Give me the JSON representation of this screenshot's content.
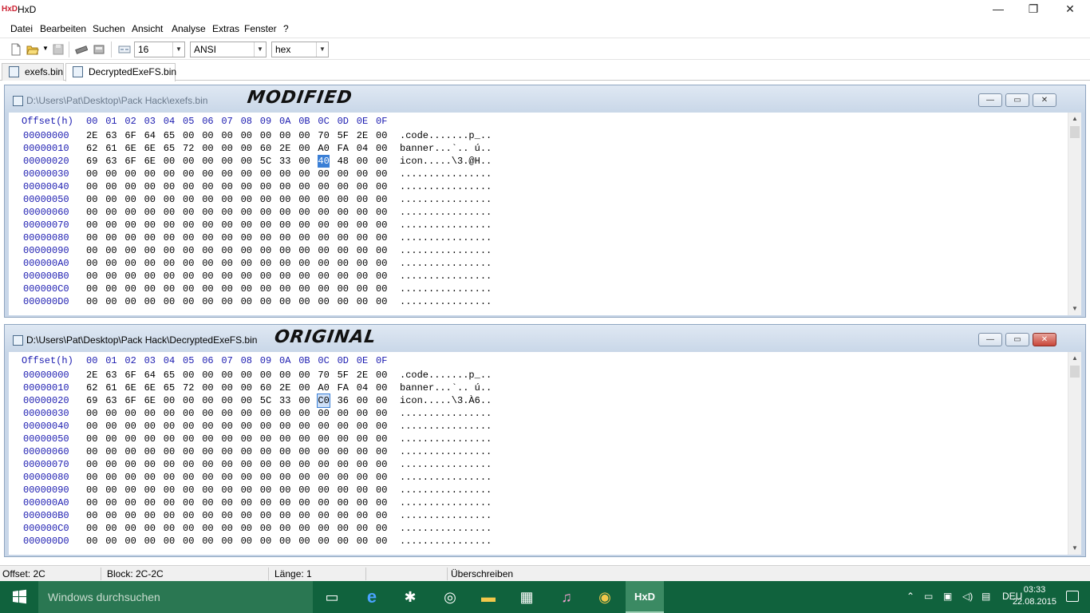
{
  "app": {
    "title": "HxD",
    "logo": "HxD"
  },
  "window_controls": {
    "minimize": "—",
    "maximize": "❐",
    "close": "✕"
  },
  "menu": [
    "Datei",
    "Bearbeiten",
    "Suchen",
    "Ansicht",
    "Analyse",
    "Extras",
    "Fenster",
    "?"
  ],
  "toolbar": {
    "bytes_per_row": "16",
    "charset": "ANSI",
    "offset_base": "hex",
    "icons": [
      "new-file-icon",
      "open-folder-icon",
      "save-icon",
      "ram-icon",
      "disk-icon",
      "bytes-per-row-icon"
    ]
  },
  "tabs": [
    {
      "label": "exefs.bin",
      "active": false
    },
    {
      "label": "DecryptedExeFS.bin",
      "active": true
    }
  ],
  "hex_header": {
    "offset_label": "Offset(h)",
    "columns": [
      "00",
      "01",
      "02",
      "03",
      "04",
      "05",
      "06",
      "07",
      "08",
      "09",
      "0A",
      "0B",
      "0C",
      "0D",
      "0E",
      "0F"
    ]
  },
  "windows": [
    {
      "path": "D:\\Users\\Pat\\Desktop\\Pack Hack\\exefs.bin",
      "label": "MODIFIED",
      "active": false,
      "selected_byte": {
        "row": 2,
        "col": 12
      },
      "rows": [
        {
          "offset": "00000000",
          "bytes": [
            "2E",
            "63",
            "6F",
            "64",
            "65",
            "00",
            "00",
            "00",
            "00",
            "00",
            "00",
            "00",
            "70",
            "5F",
            "2E",
            "00"
          ],
          "ascii": ".code.......p_.."
        },
        {
          "offset": "00000010",
          "bytes": [
            "62",
            "61",
            "6E",
            "6E",
            "65",
            "72",
            "00",
            "00",
            "00",
            "60",
            "2E",
            "00",
            "A0",
            "FA",
            "04",
            "00"
          ],
          "ascii": "banner...`.. ú.."
        },
        {
          "offset": "00000020",
          "bytes": [
            "69",
            "63",
            "6F",
            "6E",
            "00",
            "00",
            "00",
            "00",
            "00",
            "5C",
            "33",
            "00",
            "40",
            "48",
            "00",
            "00"
          ],
          "ascii": "icon.....\\3.@H.."
        },
        {
          "offset": "00000030",
          "bytes": [
            "00",
            "00",
            "00",
            "00",
            "00",
            "00",
            "00",
            "00",
            "00",
            "00",
            "00",
            "00",
            "00",
            "00",
            "00",
            "00"
          ],
          "ascii": "................"
        },
        {
          "offset": "00000040",
          "bytes": [
            "00",
            "00",
            "00",
            "00",
            "00",
            "00",
            "00",
            "00",
            "00",
            "00",
            "00",
            "00",
            "00",
            "00",
            "00",
            "00"
          ],
          "ascii": "................"
        },
        {
          "offset": "00000050",
          "bytes": [
            "00",
            "00",
            "00",
            "00",
            "00",
            "00",
            "00",
            "00",
            "00",
            "00",
            "00",
            "00",
            "00",
            "00",
            "00",
            "00"
          ],
          "ascii": "................"
        },
        {
          "offset": "00000060",
          "bytes": [
            "00",
            "00",
            "00",
            "00",
            "00",
            "00",
            "00",
            "00",
            "00",
            "00",
            "00",
            "00",
            "00",
            "00",
            "00",
            "00"
          ],
          "ascii": "................"
        },
        {
          "offset": "00000070",
          "bytes": [
            "00",
            "00",
            "00",
            "00",
            "00",
            "00",
            "00",
            "00",
            "00",
            "00",
            "00",
            "00",
            "00",
            "00",
            "00",
            "00"
          ],
          "ascii": "................"
        },
        {
          "offset": "00000080",
          "bytes": [
            "00",
            "00",
            "00",
            "00",
            "00",
            "00",
            "00",
            "00",
            "00",
            "00",
            "00",
            "00",
            "00",
            "00",
            "00",
            "00"
          ],
          "ascii": "................"
        },
        {
          "offset": "00000090",
          "bytes": [
            "00",
            "00",
            "00",
            "00",
            "00",
            "00",
            "00",
            "00",
            "00",
            "00",
            "00",
            "00",
            "00",
            "00",
            "00",
            "00"
          ],
          "ascii": "................"
        },
        {
          "offset": "000000A0",
          "bytes": [
            "00",
            "00",
            "00",
            "00",
            "00",
            "00",
            "00",
            "00",
            "00",
            "00",
            "00",
            "00",
            "00",
            "00",
            "00",
            "00"
          ],
          "ascii": "................"
        },
        {
          "offset": "000000B0",
          "bytes": [
            "00",
            "00",
            "00",
            "00",
            "00",
            "00",
            "00",
            "00",
            "00",
            "00",
            "00",
            "00",
            "00",
            "00",
            "00",
            "00"
          ],
          "ascii": "................"
        },
        {
          "offset": "000000C0",
          "bytes": [
            "00",
            "00",
            "00",
            "00",
            "00",
            "00",
            "00",
            "00",
            "00",
            "00",
            "00",
            "00",
            "00",
            "00",
            "00",
            "00"
          ],
          "ascii": "................"
        },
        {
          "offset": "000000D0",
          "bytes": [
            "00",
            "00",
            "00",
            "00",
            "00",
            "00",
            "00",
            "00",
            "00",
            "00",
            "00",
            "00",
            "00",
            "00",
            "00",
            "00"
          ],
          "ascii": "................"
        }
      ]
    },
    {
      "path": "D:\\Users\\Pat\\Desktop\\Pack Hack\\DecryptedExeFS.bin",
      "label": "ORIGINAL",
      "active": true,
      "selected_byte": {
        "row": 2,
        "col": 12
      },
      "rows": [
        {
          "offset": "00000000",
          "bytes": [
            "2E",
            "63",
            "6F",
            "64",
            "65",
            "00",
            "00",
            "00",
            "00",
            "00",
            "00",
            "00",
            "70",
            "5F",
            "2E",
            "00"
          ],
          "ascii": ".code.......p_.."
        },
        {
          "offset": "00000010",
          "bytes": [
            "62",
            "61",
            "6E",
            "6E",
            "65",
            "72",
            "00",
            "00",
            "00",
            "60",
            "2E",
            "00",
            "A0",
            "FA",
            "04",
            "00"
          ],
          "ascii": "banner...`.. ú.."
        },
        {
          "offset": "00000020",
          "bytes": [
            "69",
            "63",
            "6F",
            "6E",
            "00",
            "00",
            "00",
            "00",
            "00",
            "5C",
            "33",
            "00",
            "C0",
            "36",
            "00",
            "00"
          ],
          "ascii": "icon.....\\3.À6.."
        },
        {
          "offset": "00000030",
          "bytes": [
            "00",
            "00",
            "00",
            "00",
            "00",
            "00",
            "00",
            "00",
            "00",
            "00",
            "00",
            "00",
            "00",
            "00",
            "00",
            "00"
          ],
          "ascii": "................"
        },
        {
          "offset": "00000040",
          "bytes": [
            "00",
            "00",
            "00",
            "00",
            "00",
            "00",
            "00",
            "00",
            "00",
            "00",
            "00",
            "00",
            "00",
            "00",
            "00",
            "00"
          ],
          "ascii": "................"
        },
        {
          "offset": "00000050",
          "bytes": [
            "00",
            "00",
            "00",
            "00",
            "00",
            "00",
            "00",
            "00",
            "00",
            "00",
            "00",
            "00",
            "00",
            "00",
            "00",
            "00"
          ],
          "ascii": "................"
        },
        {
          "offset": "00000060",
          "bytes": [
            "00",
            "00",
            "00",
            "00",
            "00",
            "00",
            "00",
            "00",
            "00",
            "00",
            "00",
            "00",
            "00",
            "00",
            "00",
            "00"
          ],
          "ascii": "................"
        },
        {
          "offset": "00000070",
          "bytes": [
            "00",
            "00",
            "00",
            "00",
            "00",
            "00",
            "00",
            "00",
            "00",
            "00",
            "00",
            "00",
            "00",
            "00",
            "00",
            "00"
          ],
          "ascii": "................"
        },
        {
          "offset": "00000080",
          "bytes": [
            "00",
            "00",
            "00",
            "00",
            "00",
            "00",
            "00",
            "00",
            "00",
            "00",
            "00",
            "00",
            "00",
            "00",
            "00",
            "00"
          ],
          "ascii": "................"
        },
        {
          "offset": "00000090",
          "bytes": [
            "00",
            "00",
            "00",
            "00",
            "00",
            "00",
            "00",
            "00",
            "00",
            "00",
            "00",
            "00",
            "00",
            "00",
            "00",
            "00"
          ],
          "ascii": "................"
        },
        {
          "offset": "000000A0",
          "bytes": [
            "00",
            "00",
            "00",
            "00",
            "00",
            "00",
            "00",
            "00",
            "00",
            "00",
            "00",
            "00",
            "00",
            "00",
            "00",
            "00"
          ],
          "ascii": "................"
        },
        {
          "offset": "000000B0",
          "bytes": [
            "00",
            "00",
            "00",
            "00",
            "00",
            "00",
            "00",
            "00",
            "00",
            "00",
            "00",
            "00",
            "00",
            "00",
            "00",
            "00"
          ],
          "ascii": "................"
        },
        {
          "offset": "000000C0",
          "bytes": [
            "00",
            "00",
            "00",
            "00",
            "00",
            "00",
            "00",
            "00",
            "00",
            "00",
            "00",
            "00",
            "00",
            "00",
            "00",
            "00"
          ],
          "ascii": "................"
        },
        {
          "offset": "000000D0",
          "bytes": [
            "00",
            "00",
            "00",
            "00",
            "00",
            "00",
            "00",
            "00",
            "00",
            "00",
            "00",
            "00",
            "00",
            "00",
            "00",
            "00"
          ],
          "ascii": "................"
        }
      ]
    }
  ],
  "status": {
    "offset": "Offset: 2C",
    "block": "Block: 2C-2C",
    "length": "Länge: 1",
    "mode": "Überschreiben"
  },
  "taskbar": {
    "search_placeholder": "Windows durchsuchen",
    "apps": [
      "task-view-icon",
      "edge-icon",
      "spider-icon",
      "app-icon",
      "explorer-icon",
      "store-icon",
      "itunes-icon",
      "chrome-icon",
      "hxd-icon"
    ],
    "language": "DEU",
    "time": "03:33",
    "date": "22.08.2015"
  },
  "colors": {
    "selection": "#3a7fd6",
    "offset_text": "#1a1ab0",
    "taskbar": "#10623d"
  }
}
